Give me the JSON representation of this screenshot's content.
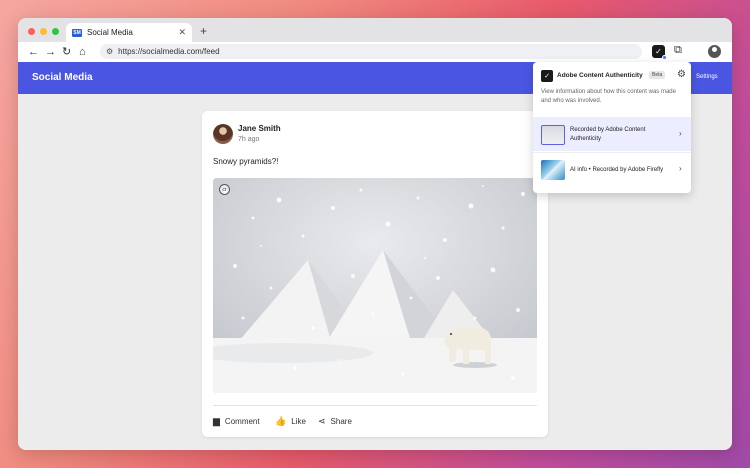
{
  "browser": {
    "tab_title": "Social Media",
    "favicon_text": "SM",
    "url": "https://socialmedia.com/feed",
    "icons": [
      "back-icon",
      "forward-icon",
      "reload-icon",
      "home-icon",
      "tune-icon",
      "content-credentials-extension-icon",
      "puzzle-icon",
      "profile-icon"
    ]
  },
  "app": {
    "title": "Social Media",
    "settings_label": "Settings",
    "accent": "#4a56e2"
  },
  "post": {
    "author": "Jane Smith",
    "time": "7h ago",
    "caption": "Snowy pyramids?!",
    "cr_label": "cr",
    "actions": {
      "comment": "Comment",
      "like": "Like",
      "share": "Share"
    }
  },
  "popup": {
    "title": "Adobe Content Authenticity",
    "beta": "Beta",
    "description": "View information about how this content was made and who was involved.",
    "rows": [
      {
        "label": "Recorded by Adobe Content Authenticity"
      },
      {
        "label": "AI info •  Recorded by Adobe Firefly"
      }
    ]
  }
}
